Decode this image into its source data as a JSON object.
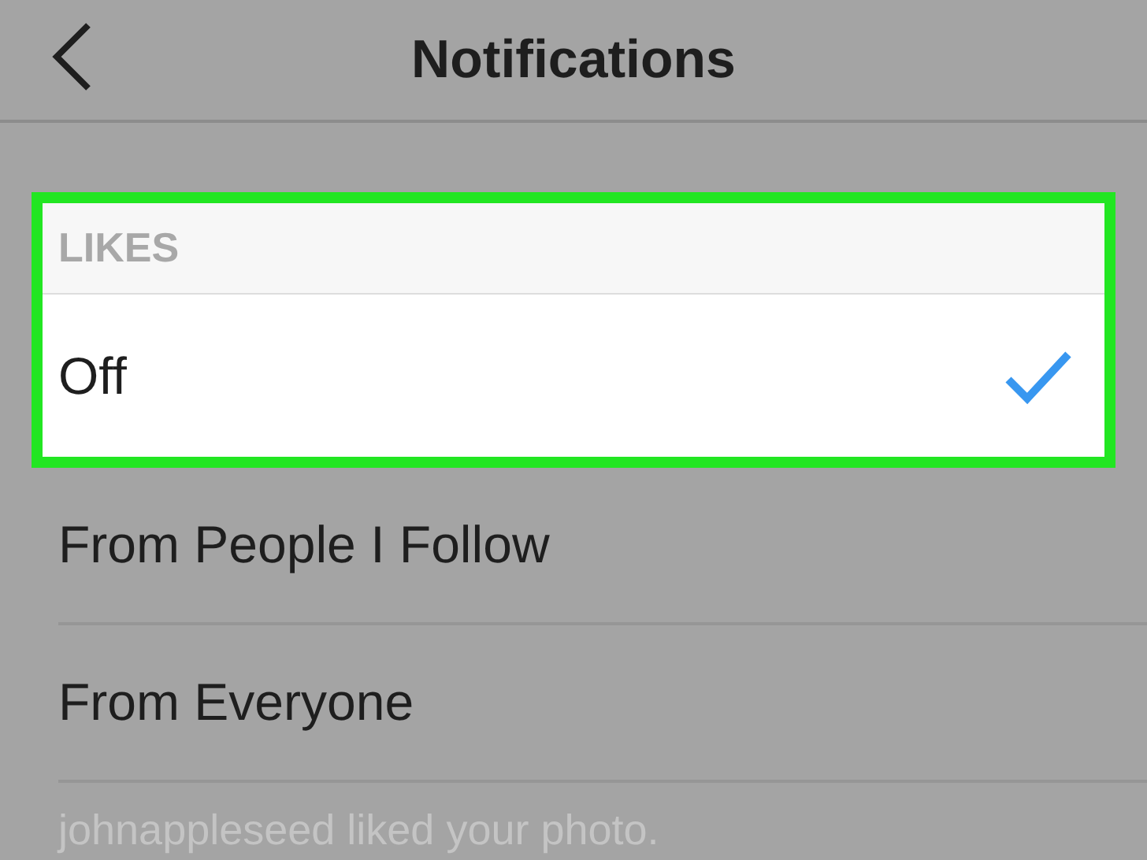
{
  "header": {
    "title": "Notifications"
  },
  "section": {
    "header": "LIKES",
    "highlighted": true,
    "options": [
      {
        "label": "Off",
        "selected": true,
        "highlighted": true
      },
      {
        "label": "From People I Follow",
        "selected": false,
        "highlighted": false
      },
      {
        "label": "From Everyone",
        "selected": false,
        "highlighted": false
      }
    ]
  },
  "preview_text": "johnappleseed liked your photo."
}
